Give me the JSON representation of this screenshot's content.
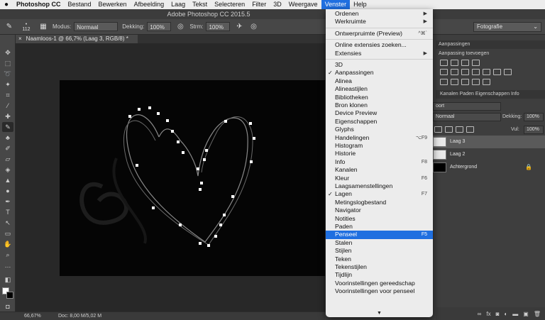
{
  "menubar": {
    "apple_icon": "apple-icon",
    "items": [
      {
        "label": "Photoshop CC",
        "app": true
      },
      {
        "label": "Bestand"
      },
      {
        "label": "Bewerken"
      },
      {
        "label": "Afbeelding"
      },
      {
        "label": "Laag"
      },
      {
        "label": "Tekst"
      },
      {
        "label": "Selecteren"
      },
      {
        "label": "Filter"
      },
      {
        "label": "3D"
      },
      {
        "label": "Weergave"
      },
      {
        "label": "Venster",
        "active": true
      },
      {
        "label": "Help"
      }
    ]
  },
  "window": {
    "title": "Adobe Photoshop CC 2015.5"
  },
  "options": {
    "brush_size": "112",
    "mode_label": "Modus:",
    "mode_value": "Normaal",
    "opacity_label": "Dekking:",
    "opacity_value": "100%",
    "flow_label": "Strm:",
    "flow_value": "100%"
  },
  "workspace_select": "Fotografie",
  "document": {
    "tab_close": "×",
    "tab_title": "Naamloos-1 @ 66,7% (Laag 3, RGB/8) *"
  },
  "status": {
    "zoom": "66,67%",
    "doc": "Doc: 8,00 M/5,02 M"
  },
  "panels": {
    "adjustments_tab": "Aanpassingen",
    "adjustments_add": "Aanpassing toevoegen",
    "layer_tabs": "Kanalen  Paden  Eigenschappen  Info",
    "kind_filter": "oort",
    "blend_mode": "Normaal",
    "opacity_label": "Dekking:",
    "opacity_value": "100%",
    "fill_label": "Vul:",
    "fill_value": "100%",
    "layers": [
      {
        "name": "Laag 3",
        "selected": true,
        "thumb": "#e8e8e8",
        "lock": ""
      },
      {
        "name": "Laag 2",
        "selected": false,
        "thumb": "#e8e8e8",
        "lock": ""
      },
      {
        "name": "Achtergrond",
        "selected": false,
        "thumb": "#000000",
        "lock": "🔒"
      }
    ]
  },
  "venster_menu": {
    "items": [
      {
        "label": "Ordenen",
        "submenu": true
      },
      {
        "label": "Werkruimte",
        "submenu": true
      },
      {
        "sep": true
      },
      {
        "label": "Ontwerpruimte (Preview)",
        "shortcut": "^⌘`"
      },
      {
        "sep": true
      },
      {
        "label": "Online extensies zoeken..."
      },
      {
        "label": "Extensies",
        "submenu": true
      },
      {
        "sep": true
      },
      {
        "label": "3D"
      },
      {
        "label": "Aanpassingen",
        "checked": true
      },
      {
        "label": "Alinea"
      },
      {
        "label": "Alineastijlen"
      },
      {
        "label": "Bibliotheken"
      },
      {
        "label": "Bron klonen"
      },
      {
        "label": "Device Preview"
      },
      {
        "label": "Eigenschappen"
      },
      {
        "label": "Glyphs"
      },
      {
        "label": "Handelingen",
        "shortcut": "⌥F9"
      },
      {
        "label": "Histogram"
      },
      {
        "label": "Historie"
      },
      {
        "label": "Info",
        "shortcut": "F8"
      },
      {
        "label": "Kanalen"
      },
      {
        "label": "Kleur",
        "shortcut": "F6"
      },
      {
        "label": "Laagsamenstellingen"
      },
      {
        "label": "Lagen",
        "checked": true,
        "shortcut": "F7"
      },
      {
        "label": "Metingslogbestand"
      },
      {
        "label": "Navigator"
      },
      {
        "label": "Notities"
      },
      {
        "label": "Paden"
      },
      {
        "label": "Penseel",
        "highlighted": true,
        "shortcut": "F5"
      },
      {
        "label": "Stalen"
      },
      {
        "label": "Stijlen"
      },
      {
        "label": "Teken"
      },
      {
        "label": "Tekenstijlen"
      },
      {
        "label": "Tijdlijn"
      },
      {
        "label": "Voorinstellingen gereedschap"
      },
      {
        "label": "Voorinstellingen voor penseel"
      }
    ],
    "scroll_arrow": "▼"
  },
  "colors": {
    "accent": "#1f6fe0",
    "menu_bg": "#ececec",
    "canvas": "#050505"
  }
}
